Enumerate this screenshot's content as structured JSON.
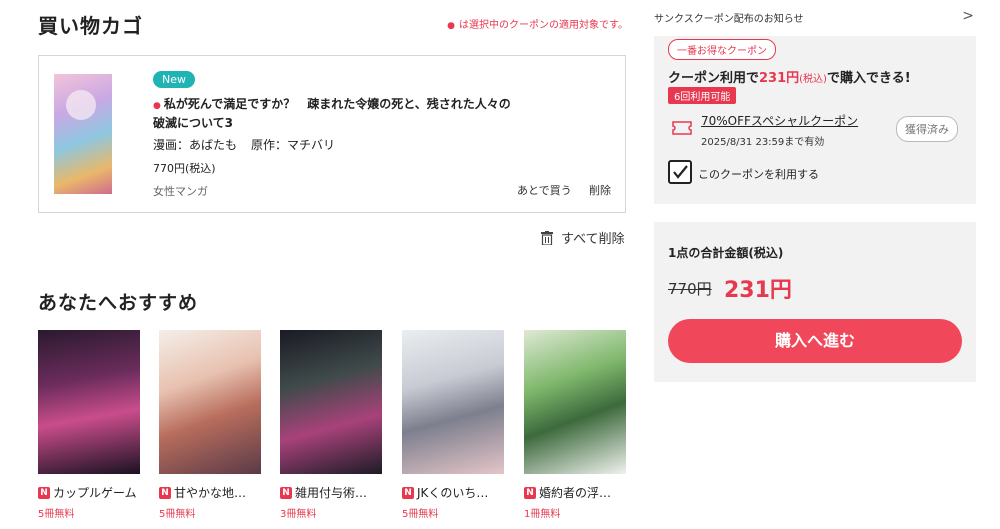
{
  "cart": {
    "title": "買い物カゴ",
    "note": "は選択中のクーポンの適用対象です。",
    "item": {
      "badge": "New",
      "title": "私が死んで満足ですか？　疎まれた令嬢の死と、残された人々の破滅について3",
      "author_label": "漫画：あばたも",
      "original_label": "原作：マチバリ",
      "price": "770円(税込)",
      "genre": "女性マンガ",
      "later_button": "あとで買う",
      "delete_button": "削除"
    },
    "delete_all": "すべて削除"
  },
  "recommend": {
    "title": "あなたへおすすめ",
    "items": [
      {
        "name": "カップルゲーム",
        "free": "5冊無料",
        "icon": "N"
      },
      {
        "name": "甘やかな地…",
        "free": "5冊無料",
        "icon": "N"
      },
      {
        "name": "雑用付与術…",
        "free": "3冊無料",
        "icon": "N"
      },
      {
        "name": "JKくのいち…",
        "free": "5冊無料",
        "icon": "N"
      },
      {
        "name": "婚約者の浮…",
        "free": "1冊無料",
        "icon": "N"
      }
    ]
  },
  "coupon": {
    "header": "サンクスクーポン配布のお知らせ",
    "best_tag": "一番お得なクーポン",
    "line_prefix": "クーポン利用で",
    "line_price": "231円",
    "line_tax": "(税込)",
    "line_suffix": "で購入できる!",
    "use_badge": "6回利用可能",
    "name": "70%OFFスペシャルクーポン",
    "expiry": "2025/8/31 23:59まで有効",
    "acquired": "獲得済み",
    "checkbox_label": "このクーポンを利用する"
  },
  "total": {
    "label": "1点の合計金額(税込)",
    "original": "770円",
    "sale": "231円",
    "buy_button": "購入へ進む"
  },
  "colors": {
    "accent": "#e8384f",
    "new_badge": "#1fb3b3",
    "panel": "#f2f2f2"
  }
}
